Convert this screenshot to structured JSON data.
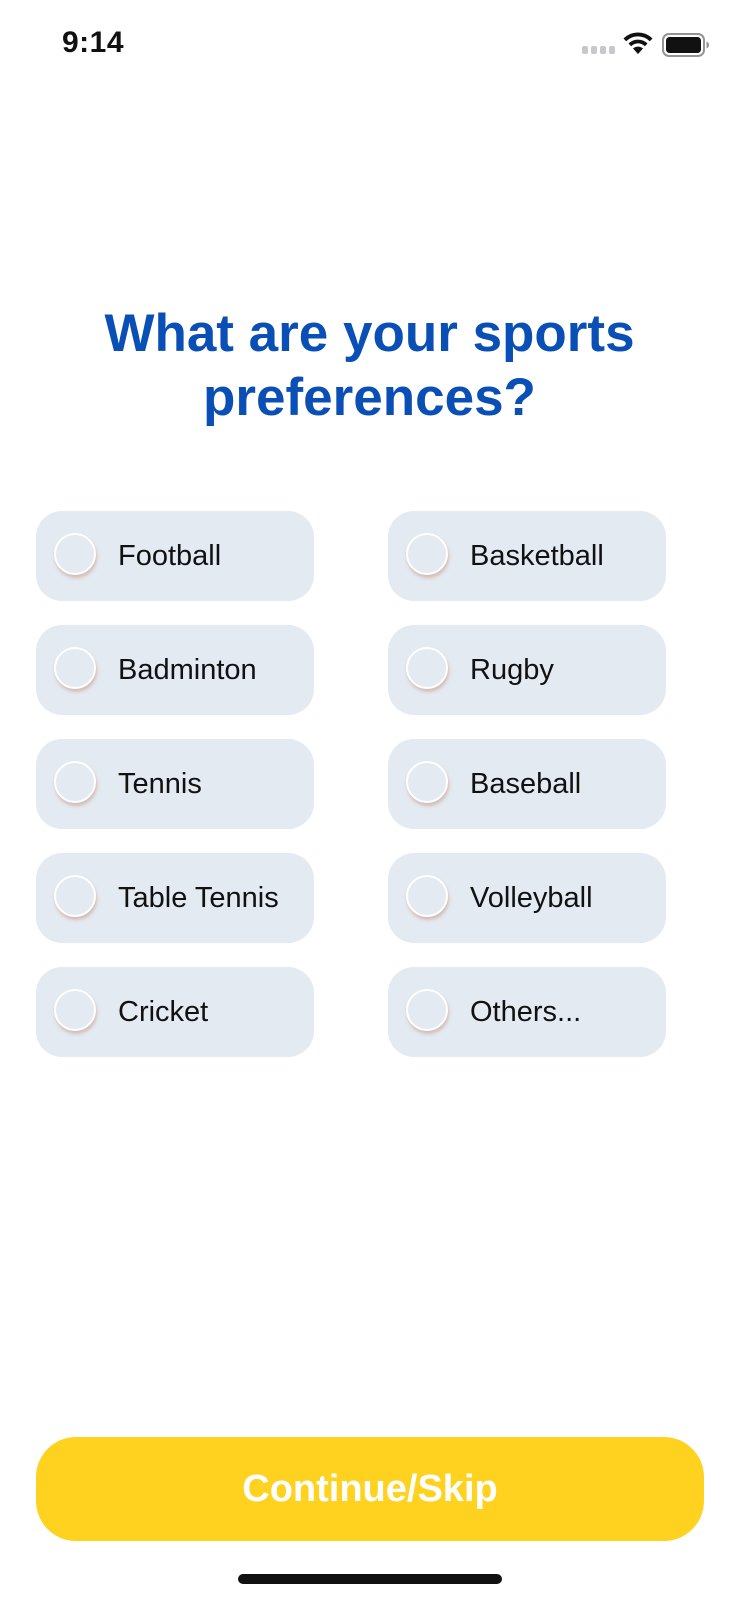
{
  "status_bar": {
    "time": "9:14"
  },
  "title": "What are your sports preferences?",
  "options": [
    {
      "label": "Football",
      "selected": false
    },
    {
      "label": "Basketball",
      "selected": false
    },
    {
      "label": "Badminton",
      "selected": false
    },
    {
      "label": "Rugby",
      "selected": false
    },
    {
      "label": "Tennis",
      "selected": false
    },
    {
      "label": "Baseball",
      "selected": false
    },
    {
      "label": "Table Tennis",
      "selected": false
    },
    {
      "label": "Volleyball",
      "selected": false
    },
    {
      "label": "Cricket",
      "selected": false
    },
    {
      "label": "Others...",
      "selected": false
    }
  ],
  "continue_button": {
    "label": "Continue/Skip"
  },
  "colors": {
    "title": "#0a4fb5",
    "option_background": "#e3eaf2",
    "button_background": "#ffd21f",
    "button_text": "#ffffff"
  },
  "icons": {
    "cellular": "signal-icon",
    "wifi": "wifi-icon",
    "battery": "battery-icon"
  }
}
